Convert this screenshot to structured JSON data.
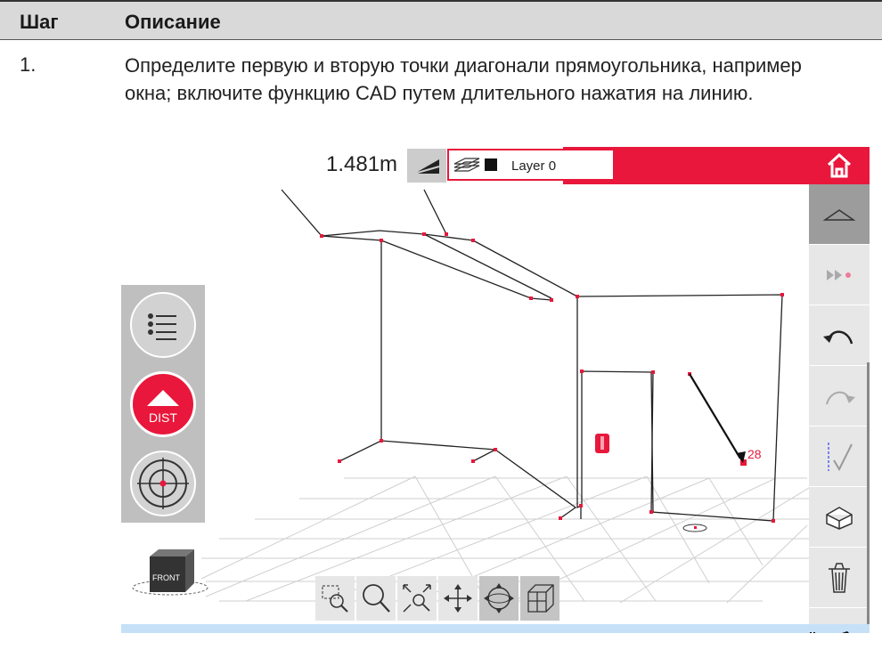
{
  "table": {
    "header_step": "Шаг",
    "header_desc": "Описание",
    "step_number": "1.",
    "description": "Определите первую и вторую точки диагонали прямоугольника, например окна; включите функцию CAD путем длительного нажатия на линию."
  },
  "app": {
    "distance_value": "1.481m",
    "layer_name": "Layer 0",
    "point_label": "28",
    "left_buttons": [
      "list-icon",
      "dist-button",
      "target-icon"
    ],
    "dist_button_label": "DIST",
    "cube_label": "FRONT",
    "side_buttons": [
      "collapse-icon",
      "fast-forward-icon",
      "undo-icon",
      "redo-icon",
      "check-icon",
      "box-view-icon",
      "trash-icon"
    ],
    "tools": [
      "zoom-window-icon",
      "zoom-icon",
      "zoom-extents-icon",
      "pan-icon",
      "orbit-icon",
      "wireframe-box-icon"
    ],
    "status_icons": [
      "power-plug-icon",
      "laser-icon"
    ],
    "accent_color": "#e8173b",
    "status_bar_color": "#c6e0f8"
  }
}
